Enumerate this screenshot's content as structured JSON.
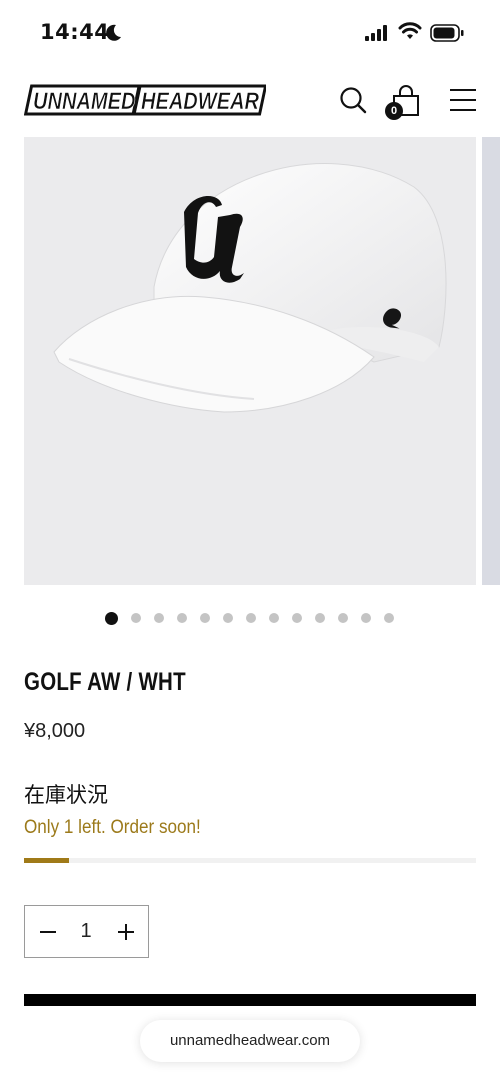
{
  "status_bar": {
    "time": "14:44",
    "icons": [
      "moon-icon",
      "cellular-signal-icon",
      "wifi-icon",
      "battery-icon"
    ]
  },
  "header": {
    "logo_text": "UNNAMED HEADWEAR",
    "cart_count": "0",
    "icons": [
      "search-icon",
      "shopping-bag-icon",
      "hamburger-menu-icon"
    ]
  },
  "gallery": {
    "image_subject": "white baseball cap with black embroidered gothic U logo",
    "total_slides": 13,
    "current_slide": 1
  },
  "product": {
    "title": "GOLF AW / WHT",
    "price": "¥8,000",
    "stock_heading": "在庫状況",
    "stock_message": "Only 1 left. Order soon!",
    "stock_level": 0.1
  },
  "quantity": {
    "value": "1"
  },
  "browser": {
    "url": "unnamedheadwear.com"
  },
  "colors": {
    "accent_gold": "#a07a18",
    "text": "#111111",
    "background": "#ffffff",
    "image_bg": "#ebebed"
  }
}
